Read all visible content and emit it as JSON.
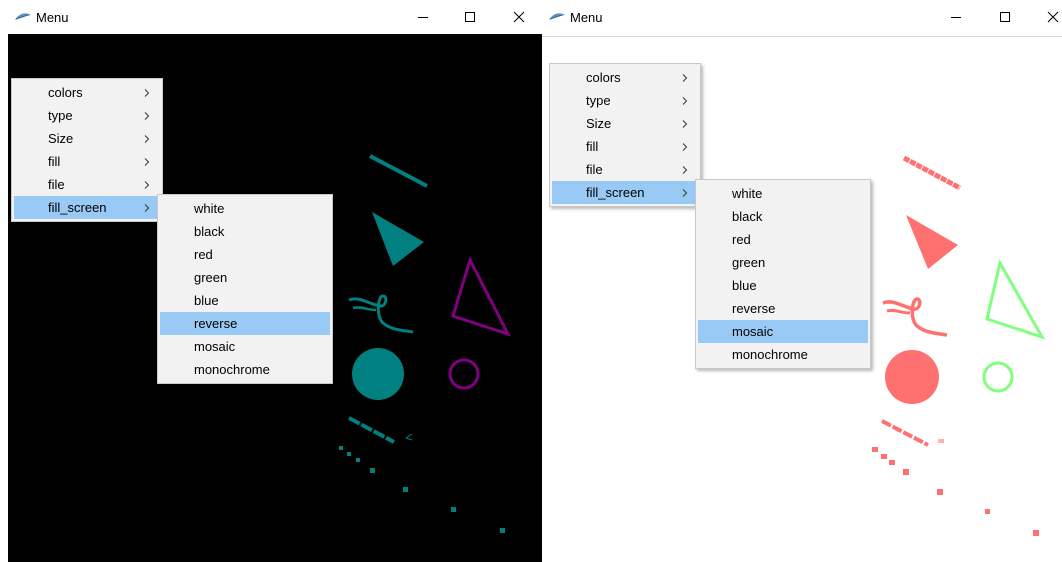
{
  "left_window": {
    "title": "Menu",
    "canvas_color": "#000000",
    "shape_color": "#008080",
    "outline_color": "#800080",
    "menu": {
      "items": [
        {
          "label": "colors"
        },
        {
          "label": "type"
        },
        {
          "label": "Size"
        },
        {
          "label": "fill"
        },
        {
          "label": "file"
        },
        {
          "label": "fill_screen",
          "highlighted": true
        }
      ]
    },
    "submenu": {
      "items": [
        {
          "label": "white"
        },
        {
          "label": "black"
        },
        {
          "label": "red"
        },
        {
          "label": "green"
        },
        {
          "label": "blue"
        },
        {
          "label": "reverse",
          "highlighted": true
        },
        {
          "label": "mosaic"
        },
        {
          "label": "monochrome"
        }
      ]
    }
  },
  "right_window": {
    "title": "Menu",
    "canvas_color": "#ffffff",
    "shape_color": "#ff7070",
    "outline_color": "#80ff80",
    "menu": {
      "items": [
        {
          "label": "colors"
        },
        {
          "label": "type"
        },
        {
          "label": "Size"
        },
        {
          "label": "fill"
        },
        {
          "label": "file"
        },
        {
          "label": "fill_screen",
          "highlighted": true
        }
      ]
    },
    "submenu": {
      "items": [
        {
          "label": "white"
        },
        {
          "label": "black"
        },
        {
          "label": "red"
        },
        {
          "label": "green"
        },
        {
          "label": "blue"
        },
        {
          "label": "reverse"
        },
        {
          "label": "mosaic",
          "highlighted": true
        },
        {
          "label": "monochrome"
        }
      ]
    }
  },
  "icons": {
    "app": "feather-icon",
    "minimize": "minimize-icon",
    "maximize": "maximize-icon",
    "close": "close-icon",
    "submenu_arrow": "chevron-right-icon"
  }
}
